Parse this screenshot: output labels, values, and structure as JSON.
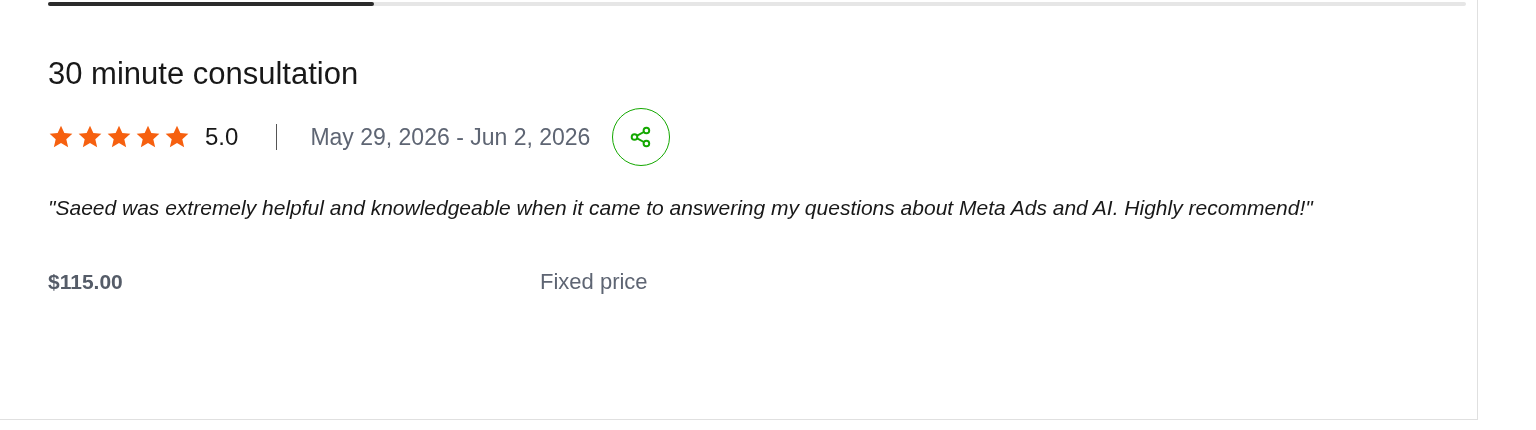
{
  "progress": {
    "level": 0.23
  },
  "title": "30 minute consultation",
  "rating": {
    "stars": 5,
    "score": "5.0"
  },
  "dates": "May 29, 2026 - Jun 2, 2026",
  "review": "\"Saeed was extremely helpful and knowledgeable when it came to answering my questions about Meta Ads and AI. Highly recommend!\"",
  "price": "$115.00",
  "price_type": "Fixed price"
}
